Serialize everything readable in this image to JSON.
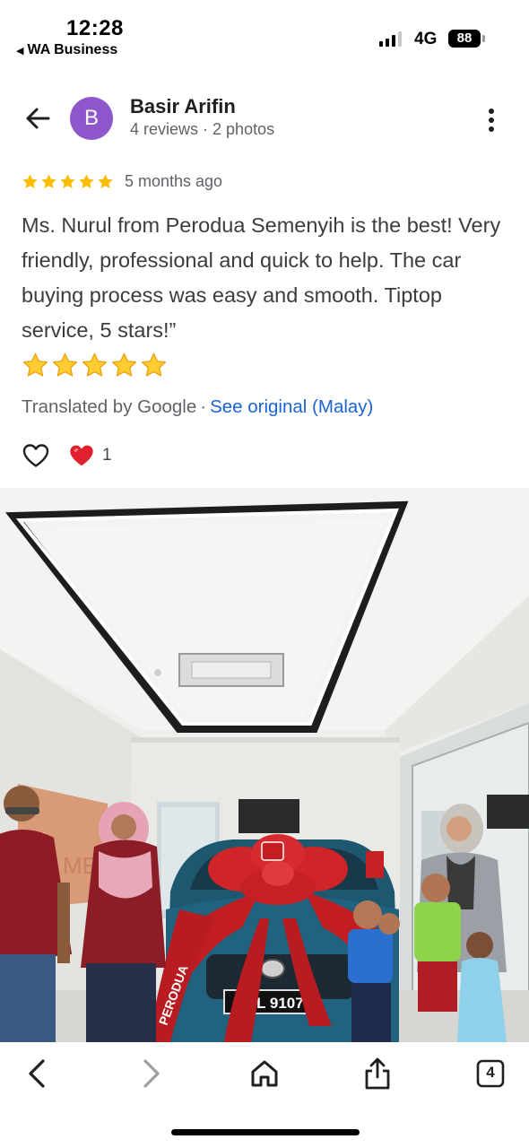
{
  "status_bar": {
    "time": "12:28",
    "back_app": "WA Business",
    "network": "4G",
    "battery": "88"
  },
  "reviewer": {
    "avatar_letter": "B",
    "avatar_color": "#8e57cc",
    "name": "Basir Arifin",
    "reviews": "4 reviews",
    "photos": "2 photos"
  },
  "review": {
    "rating": 5,
    "time_ago": "5 months ago",
    "text": "Ms. Nurul from Perodua Semenyih is the best! Very friendly, professional and quick to help. The car buying process was easy and smooth. Tiptop service, 5 stars!”",
    "emoji_stars": 5,
    "translated_by": "Translated by Google",
    "see_original": "See original (Malay)",
    "star_color": "#fbbc04",
    "link_color": "#1a64d3"
  },
  "reactions": {
    "like_icon": "heart-outline-icon",
    "heart_icon": "red-heart-icon",
    "heart_count": "1"
  },
  "photo": {
    "plate": "JYL 9107",
    "brand_sign": "PERODUA"
  },
  "toolbar": {
    "items": [
      "back-icon",
      "forward-icon",
      "home-icon",
      "share-icon",
      "tabs-icon"
    ],
    "tab_count": "4"
  }
}
